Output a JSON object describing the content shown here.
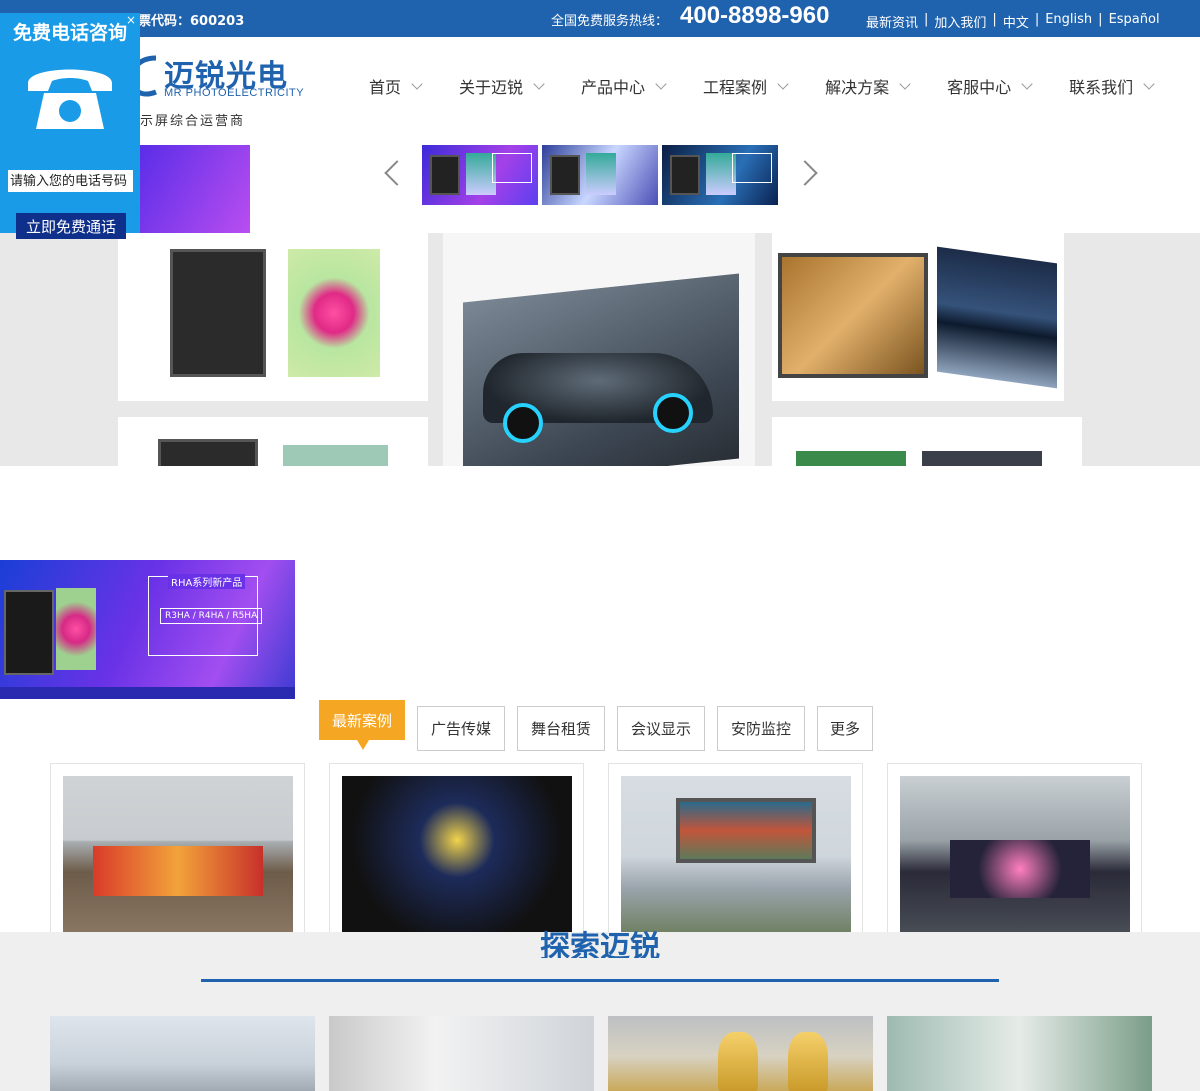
{
  "topbar": {
    "stock": "票代码：600203",
    "hotline_label": "全国免费服务热线：",
    "hotline_number": "400-8898-960",
    "links": [
      "最新资讯",
      "加入我们",
      "中文",
      "English",
      "Español"
    ],
    "separator": "|"
  },
  "header": {
    "logo_cn": "迈锐光电",
    "logo_en": "MR PHOTOELECTRICITY",
    "tagline": "示屏综合运营商",
    "nav": [
      "首页",
      "关于迈锐",
      "产品中心",
      "工程案例",
      "解决方案",
      "客服中心",
      "联系我们"
    ]
  },
  "cases": {
    "active_tab": "最新案例",
    "tabs": [
      "广告传媒",
      "舞台租赁",
      "会议显示",
      "安防监控",
      "更多"
    ]
  },
  "explore": {
    "title": "探索迈锐"
  },
  "banner": {
    "title": "RHA系列新产品",
    "models": "R3HA / R4HA / R5HA"
  },
  "call_widget": {
    "title": "免费电话咨询",
    "close": "×",
    "input_placeholder": "请输入您的电话号码",
    "button": "立即免费通话"
  },
  "colors": {
    "brand_blue": "#1f62ad",
    "accent_orange": "#f5a623",
    "widget_blue": "#1a9be8"
  }
}
